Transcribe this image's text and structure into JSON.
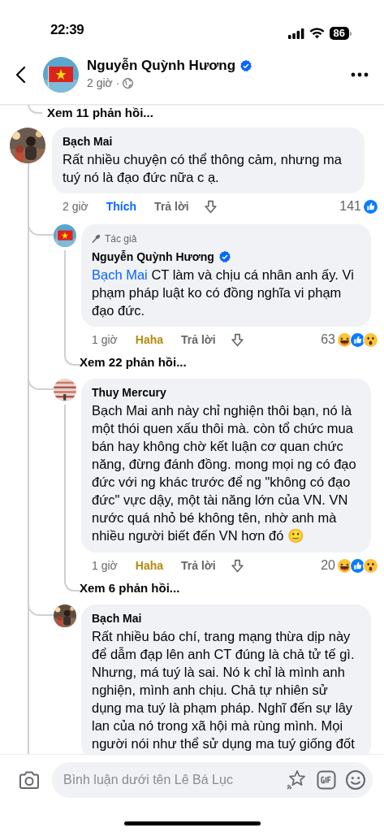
{
  "status_bar": {
    "time": "22:39",
    "battery": "86"
  },
  "header": {
    "name": "Nguyễn Quỳnh Hương",
    "verified": true,
    "time": "2 giờ",
    "separator": "·"
  },
  "hidden_replies_link": "Xem 11 phản hồi...",
  "comments": [
    {
      "kind": "top",
      "author": "Bạch Mai",
      "verified": false,
      "text": "Rất nhiều chuyện có thể thông cảm, nhưng ma tuý nó là đạo đức nữa c ạ.",
      "time": "2 giờ",
      "my_reaction": {
        "kind": "like",
        "label": "Thích"
      },
      "reply": "Trả lời",
      "count": "141",
      "reactions": [
        {
          "kind": "like"
        }
      ]
    },
    {
      "kind": "reply",
      "badge": "Tác giả",
      "author": "Nguyễn Quỳnh Hương",
      "verified": true,
      "mention": "Bạch Mai",
      "text": "CT làm và chịu cá nhân anh ấy. Vi phạm pháp luật ko có đồng nghĩa vi phạm đạo đức.",
      "time": "1 giờ",
      "my_reaction": {
        "kind": "haha",
        "label": "Haha"
      },
      "reply": "Trả lời",
      "count": "63",
      "reactions": [
        {
          "kind": "haha"
        },
        {
          "kind": "like"
        },
        {
          "kind": "wow"
        }
      ],
      "more": "Xem 22 phản hồi..."
    },
    {
      "kind": "reply",
      "author": "Thuy Mercury",
      "verified": false,
      "text": "Bạch Mai anh này chỉ nghiện thôi bạn, nó là một thói quen xấu thôi mà. còn tổ chức mua bán hay không chờ kết luận cơ quan chức năng, đừng đánh đồng. mong mọi ng có đạo đức với ng khác trước để ng \"không có đạo đức\" vực dậy, một tài năng lớn của VN. VN nước quá nhỏ bé không tên, nhờ anh mà nhiều người biết đến VN hơn đó",
      "emoji": "🙂",
      "time": "1 giờ",
      "my_reaction": {
        "kind": "haha",
        "label": "Haha"
      },
      "reply": "Trả lời",
      "count": "20",
      "reactions": [
        {
          "kind": "haha"
        },
        {
          "kind": "like"
        },
        {
          "kind": "wow"
        }
      ],
      "more": "Xem 6 phản hồi..."
    },
    {
      "kind": "reply",
      "author": "Bạch Mai",
      "verified": false,
      "text": "Rất nhiều báo chí, trang mạng thừa dịp này để dẫm đạp lên anh CT đúng là chả tử tế gì. Nhưng, má tuý là sai. Nó k chỉ là mình anh nghiện, mình anh chịu. Chả tự nhiên sử dụng ma tuý là phạm pháp. Nghĩ đến sự lây lan của nó trong xã hội mà rùng mình. Mọi người nói như thể sử dụng ma tuý giống đốt"
    }
  ],
  "composer": {
    "placeholder": "Bình luận dưới tên Lê Bá Lục"
  }
}
